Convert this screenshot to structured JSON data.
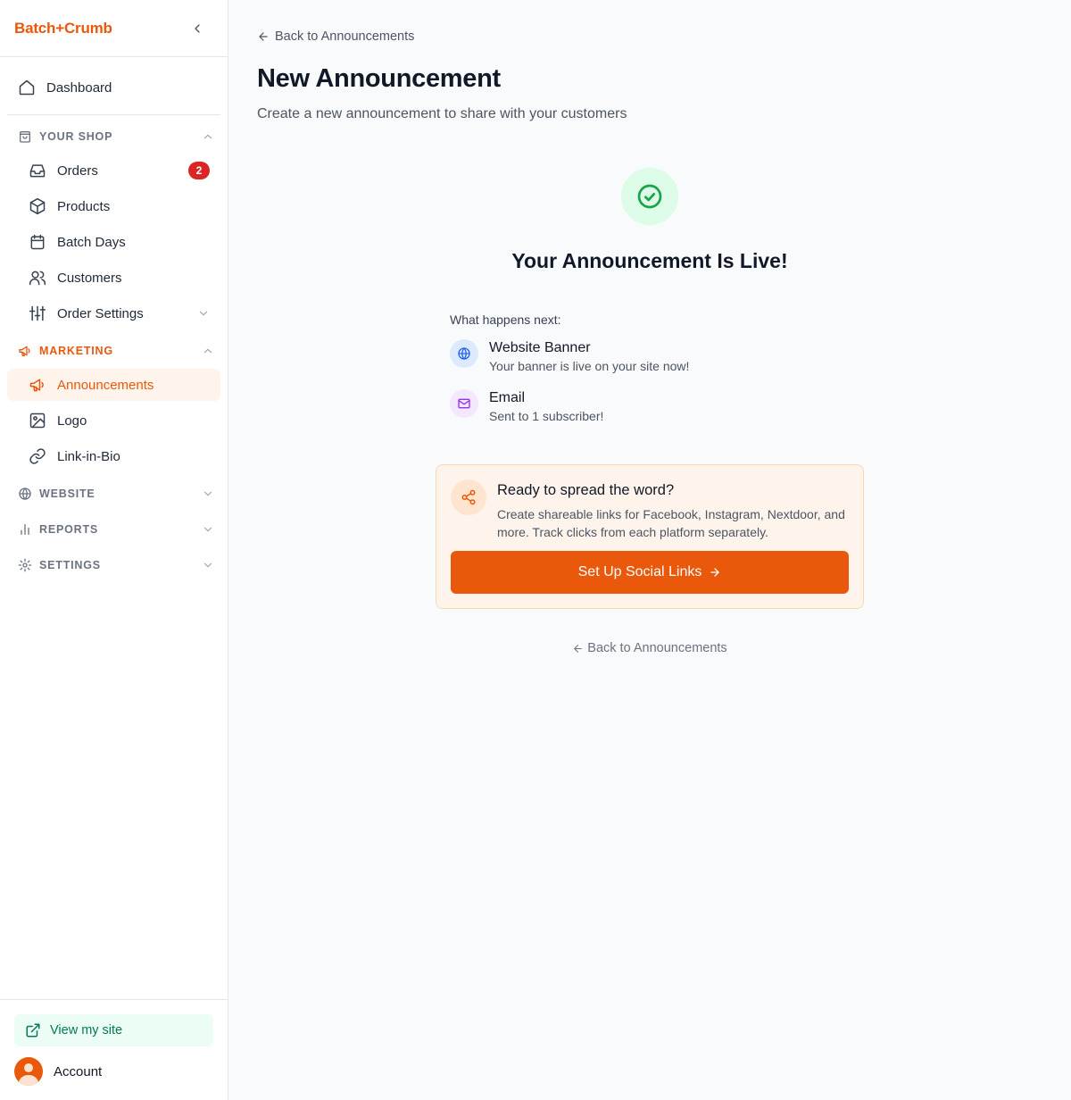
{
  "app": {
    "brand": "Batch+Crumb"
  },
  "colors": {
    "accent": "#ea580c",
    "success": "#16a34a",
    "badge": "#dc2626",
    "link_green": "#047857"
  },
  "sidebar": {
    "dashboard": {
      "label": "Dashboard",
      "icon": "home-icon"
    },
    "sections": {
      "shop": {
        "title": "YOUR SHOP",
        "icon": "shopping-bag-icon",
        "expanded": true,
        "items": [
          {
            "label": "Orders",
            "icon": "inbox-icon",
            "badge": "2"
          },
          {
            "label": "Products",
            "icon": "box-icon"
          },
          {
            "label": "Batch Days",
            "icon": "calendar-icon"
          },
          {
            "label": "Customers",
            "icon": "users-icon"
          },
          {
            "label": "Order Settings",
            "icon": "sliders-icon"
          }
        ]
      },
      "marketing": {
        "title": "MARKETING",
        "icon": "megaphone-icon",
        "expanded": true,
        "items": [
          {
            "label": "Announcements",
            "icon": "megaphone-icon",
            "active": true
          },
          {
            "label": "Logo",
            "icon": "image-icon"
          },
          {
            "label": "Link-in-Bio",
            "icon": "link-icon"
          }
        ]
      },
      "website": {
        "title": "WEBSITE",
        "icon": "globe-icon",
        "expanded": false
      },
      "reports": {
        "title": "REPORTS",
        "icon": "bar-chart-icon",
        "expanded": false
      },
      "settings": {
        "title": "SETTINGS",
        "icon": "gear-icon",
        "expanded": false
      }
    },
    "footer": {
      "view_site": "View my site",
      "account": "Account"
    }
  },
  "main": {
    "back_link": "Back to Announcements",
    "title": "New Announcement",
    "subtitle": "Create a new announcement to share with your customers",
    "success_title": "Your Announcement Is Live!",
    "next_label": "What happens next:",
    "next_items": [
      {
        "title": "Website Banner",
        "desc": "Your banner is live on your site now!",
        "icon": "globe-icon"
      },
      {
        "title": "Email",
        "desc": "Sent to 1 subscriber!",
        "icon": "mail-icon"
      }
    ],
    "spread": {
      "title": "Ready to spread the word?",
      "desc": "Create shareable links for Facebook, Instagram, Nextdoor, and more. Track clicks from each platform separately.",
      "button": "Set Up Social Links"
    },
    "back_link_bottom": "Back to Announcements"
  }
}
